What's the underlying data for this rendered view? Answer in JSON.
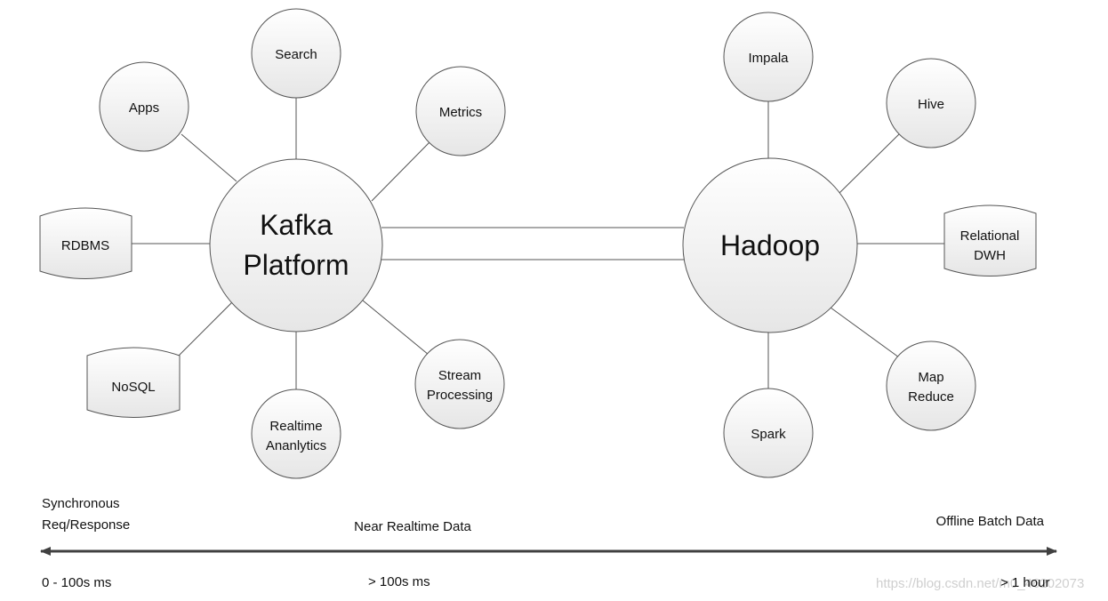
{
  "hubs": {
    "kafka": [
      "Kafka",
      "Platform"
    ],
    "hadoop": "Hadoop"
  },
  "kafka_nodes": {
    "search": "Search",
    "apps": "Apps",
    "metrics": "Metrics",
    "rdbms": "RDBMS",
    "nosql": "NoSQL",
    "realtime": [
      "Realtime",
      "Ananlytics"
    ],
    "stream": [
      "Stream",
      "Processing"
    ]
  },
  "hadoop_nodes": {
    "impala": "Impala",
    "hive": "Hive",
    "dwh": [
      "Relational",
      "DWH"
    ],
    "mapreduce": [
      "Map",
      "Reduce"
    ],
    "spark": "Spark"
  },
  "timeline": {
    "left_label": [
      "Synchronous",
      "Req/Response"
    ],
    "middle_label": "Near Realtime Data",
    "right_label": "Offline Batch Data",
    "left_latency": "0 - 100s ms",
    "middle_latency": "> 100s ms",
    "right_latency": "> 1 hour"
  },
  "watermark": "https://blog.csdn.net/m0_46202073"
}
